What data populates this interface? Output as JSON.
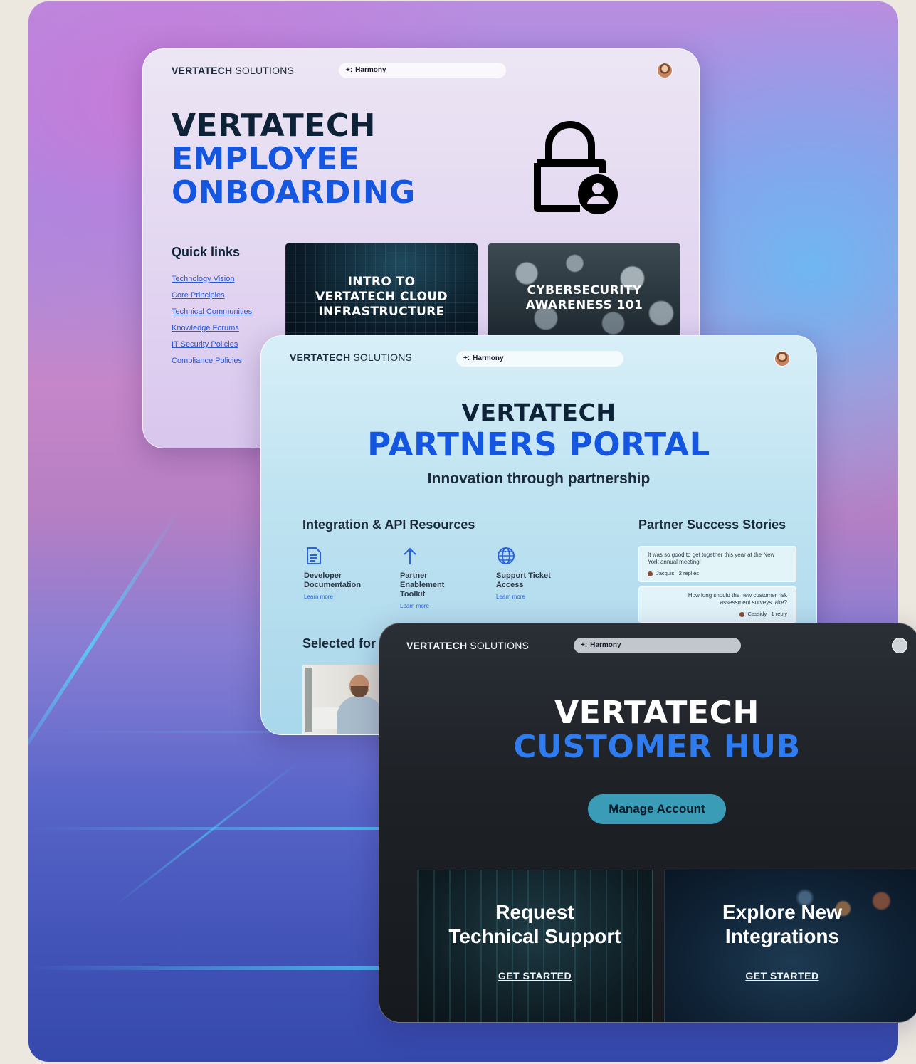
{
  "colors": {
    "accent_blue": "#1556e0",
    "dark_navy": "#0d2236",
    "customer_hub_blue": "#2e7cf0",
    "manage_button": "#3a9cb7"
  },
  "employee": {
    "brand_bold": "VERTATECH",
    "brand_light": "SOLUTIONS",
    "search_label": "Harmony",
    "hero_line1": "VERTATECH",
    "hero_line2": "EMPLOYEE",
    "hero_line3": "ONBOARDING",
    "lock_icon": "lock-user-icon",
    "quick_links_title": "Quick links",
    "quick_links": [
      "Technology Vision",
      "Core Principles",
      "Technical Communities",
      "Knowledge Forums",
      "IT Security Policies",
      "Compliance Policies"
    ],
    "tiles": [
      "INTRO TO VERTATECH CLOUD INFRASTRUCTURE",
      "CYBERSECURITY AWARENESS 101"
    ]
  },
  "partners": {
    "brand_bold": "VERTATECH",
    "brand_light": "SOLUTIONS",
    "search_label": "Harmony",
    "hero_line1": "VERTATECH",
    "hero_line2": "PARTNERS PORTAL",
    "tagline": "Innovation through partnership",
    "integration_title": "Integration & API Resources",
    "resources": [
      {
        "label": "Developer Documentation",
        "link": "Learn more",
        "icon": "document-icon"
      },
      {
        "label": "Partner Enablement Toolkit",
        "link": "Learn more",
        "icon": "arrow-up-icon"
      },
      {
        "label": "Support Ticket Access",
        "link": "Learn more",
        "icon": "globe-icon"
      }
    ],
    "stories_title": "Partner Success Stories",
    "stories": [
      {
        "text": "It was so good to get together this year at the New York annual meeting!",
        "author": "Jacquis",
        "replies": "2 replies"
      },
      {
        "text": "How long should the new customer risk assessment surveys take?",
        "author": "Cassidy",
        "replies": "1 reply"
      }
    ],
    "selected_title": "Selected for y"
  },
  "customer": {
    "brand_bold": "VERTATECH",
    "brand_light": "SOLUTIONS",
    "search_label": "Harmony",
    "hero_line1": "VERTATECH",
    "hero_line2": "CUSTOMER HUB",
    "manage_button": "Manage Account",
    "cards": [
      {
        "title_line1": "Request",
        "title_line2": "Technical Support",
        "cta": "GET STARTED"
      },
      {
        "title_line1": "Explore New",
        "title_line2": "Integrations",
        "cta": "GET STARTED"
      }
    ]
  }
}
